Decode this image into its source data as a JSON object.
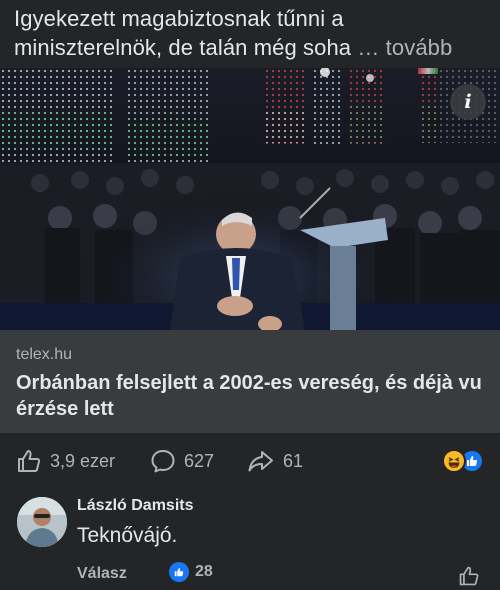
{
  "post": {
    "text": "Igyekezett magabiztosnak tűnni a miniszterelnök, de talán még soha ",
    "more": "… tovább"
  },
  "photo": {
    "info_glyph": "i"
  },
  "link": {
    "domain": "telex.hu",
    "title": "Orbánban felsejlett a 2002-es vereség, és déjà vu érzése lett"
  },
  "actions": {
    "likes": "3,9 ezer",
    "comments": "627",
    "shares": "61",
    "reactions": [
      "haha-icon",
      "like-icon"
    ]
  },
  "comment": {
    "author": "László Damsits",
    "text": "Teknővájó.",
    "reply": "Válasz",
    "reaction_count": "28"
  },
  "colors": {
    "background": "#242526",
    "card": "#3a3b3c",
    "text_primary": "#e4e6eb",
    "text_secondary": "#b0b3b8",
    "accent_blue": "#1877f2",
    "haha_yellow": "#f7b928"
  }
}
